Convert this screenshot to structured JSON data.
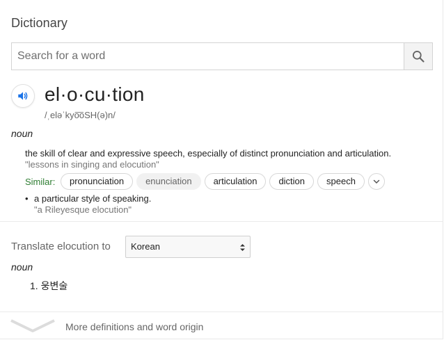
{
  "header": {
    "title": "Dictionary"
  },
  "search": {
    "placeholder": "Search for a word",
    "value": ""
  },
  "entry": {
    "word": "el·o·cu·tion",
    "phonetic": "/ˌeləˈkyo͞oSH(ə)n/",
    "part_of_speech": "noun",
    "senses": [
      {
        "definition": "the skill of clear and expressive speech, especially of distinct pronunciation and articulation.",
        "example": "\"lessons in singing and elocution\""
      },
      {
        "bullet": "•",
        "definition": "a particular style of speaking.",
        "example": "\"a Rileyesque elocution\""
      }
    ],
    "similar_label": "Similar:",
    "similar": [
      "pronunciation",
      "enunciation",
      "articulation",
      "diction",
      "speech"
    ]
  },
  "translate": {
    "label": "Translate elocution to",
    "language": "Korean",
    "part_of_speech": "noun",
    "items": [
      {
        "number": "1.",
        "text": "웅변술"
      }
    ]
  },
  "footer": {
    "more_label": "More definitions and word origin"
  },
  "colors": {
    "accent": "#1a73e8",
    "similar": "#2e7d32",
    "muted_text": "#777777"
  },
  "icons": [
    "search-icon",
    "speaker-icon",
    "chevron-down-icon",
    "select-arrows-icon",
    "expand-chevron-icon"
  ]
}
